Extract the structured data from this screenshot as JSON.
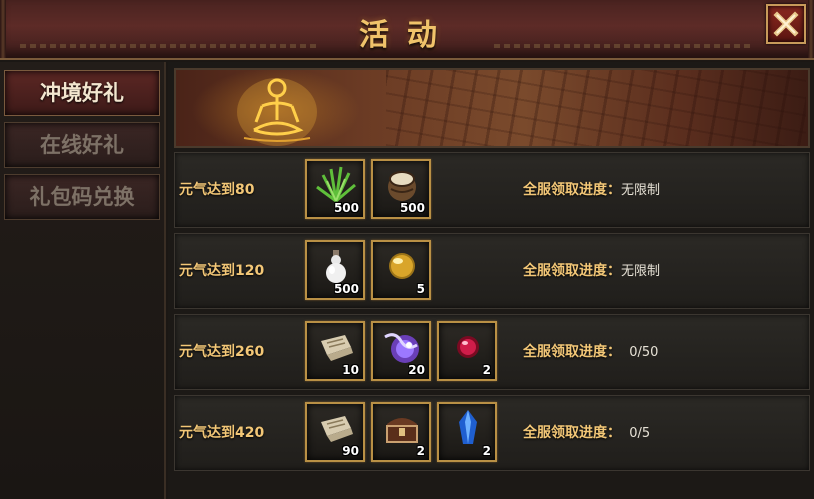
{
  "header": {
    "title": "活动",
    "close_icon": "close-icon"
  },
  "sidebar": {
    "tabs": [
      {
        "label": "冲境好礼",
        "active": true
      },
      {
        "label": "在线好礼",
        "active": false
      },
      {
        "label": "礼包码兑换",
        "active": false
      }
    ]
  },
  "banner": {
    "figure_icon": "meditating-figure-icon"
  },
  "rewards": [
    {
      "condition": "元气达到80",
      "progress_label": "全服领取进度：",
      "progress_value": "无限制",
      "items": [
        {
          "icon": "herb-grass-icon",
          "qty": "500"
        },
        {
          "icon": "drum-pouch-icon",
          "qty": "500"
        }
      ]
    },
    {
      "condition": "元气达到120",
      "progress_label": "全服领取进度：",
      "progress_value": "无限制",
      "items": [
        {
          "icon": "white-gourd-bottle-icon",
          "qty": "500"
        },
        {
          "icon": "gold-orb-icon",
          "qty": "5"
        }
      ]
    },
    {
      "condition": "元气达到260",
      "progress_label": "全服领取进度：",
      "progress_value": "  0/50",
      "items": [
        {
          "icon": "parchment-scroll-icon",
          "qty": "10"
        },
        {
          "icon": "purple-spirit-icon",
          "qty": "20"
        },
        {
          "icon": "red-gem-icon",
          "qty": "2"
        }
      ]
    },
    {
      "condition": "元气达到420",
      "progress_label": "全服领取进度：",
      "progress_value": "  0/5",
      "items": [
        {
          "icon": "parchment-scroll-icon",
          "qty": "90"
        },
        {
          "icon": "treasure-chest-icon",
          "qty": "2"
        },
        {
          "icon": "blue-crystal-icon",
          "qty": "2"
        }
      ]
    }
  ],
  "colors": {
    "gold_text": "#f3c777",
    "slot_border": "#b99045",
    "header_bg": "#5d2b27"
  }
}
